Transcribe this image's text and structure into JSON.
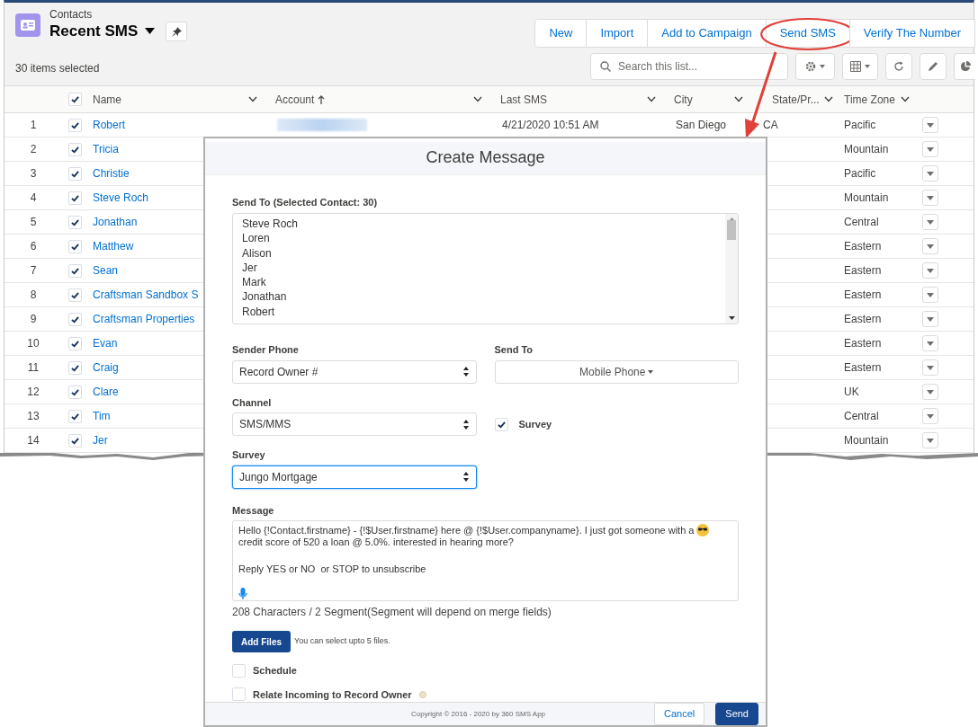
{
  "header": {
    "object_label": "Contacts",
    "list_name": "Recent SMS",
    "selection_count": "30 items selected"
  },
  "actions": [
    {
      "label": "New",
      "circled": false
    },
    {
      "label": "Import",
      "circled": false
    },
    {
      "label": "Add to Campaign",
      "circled": false
    },
    {
      "label": "Send SMS",
      "circled": true
    },
    {
      "label": "Verify The Number",
      "circled": false
    }
  ],
  "search": {
    "placeholder": "Search this list..."
  },
  "select_all": {
    "checked": true
  },
  "columns": [
    {
      "label": "Name"
    },
    {
      "label": "Account",
      "sorted_ascending": true
    },
    {
      "label": "Last SMS"
    },
    {
      "label": "City"
    },
    {
      "label": "State/Pr..."
    },
    {
      "label": "Time Zone"
    }
  ],
  "rows": [
    {
      "number": "1",
      "checked": true,
      "name": "Robert",
      "account_blurred": true,
      "last_sms": "4/21/2020 10:51 AM",
      "city": "San Diego",
      "state": "CA",
      "time_zone": "Pacific"
    },
    {
      "number": "2",
      "checked": true,
      "name": "Tricia",
      "time_zone": "Mountain"
    },
    {
      "number": "3",
      "checked": true,
      "name": "Christie",
      "time_zone": "Pacific"
    },
    {
      "number": "4",
      "checked": true,
      "name": "Steve Roch",
      "time_zone": "Mountain"
    },
    {
      "number": "5",
      "checked": true,
      "name": "Jonathan",
      "time_zone": "Central"
    },
    {
      "number": "6",
      "checked": true,
      "name": "Matthew",
      "time_zone": "Eastern"
    },
    {
      "number": "7",
      "checked": true,
      "name": "Sean",
      "time_zone": "Eastern"
    },
    {
      "number": "8",
      "checked": true,
      "name": "Craftsman Sandbox S",
      "time_zone": "Eastern"
    },
    {
      "number": "9",
      "checked": true,
      "name": "Craftsman Properties",
      "time_zone": "Eastern"
    },
    {
      "number": "10",
      "checked": true,
      "name": "Evan",
      "time_zone": "Eastern"
    },
    {
      "number": "11",
      "checked": true,
      "name": "Craig",
      "time_zone": "Eastern"
    },
    {
      "number": "12",
      "checked": true,
      "name": "Clare",
      "time_zone": "UK"
    },
    {
      "number": "13",
      "checked": true,
      "name": "Tim",
      "time_zone": "Central"
    },
    {
      "number": "14",
      "checked": true,
      "name": "Jer",
      "time_zone": "Mountain"
    }
  ],
  "modal": {
    "title": "Create Message",
    "recipients": {
      "label": "Send To (Selected Contact: 30)",
      "names": [
        "Steve Roch",
        "Loren",
        "Alison",
        "Jer",
        "Mark",
        "Jonathan",
        "Robert"
      ]
    },
    "sender_phone": {
      "label": "Sender Phone",
      "value": "Record Owner #"
    },
    "send_to": {
      "label": "Send To",
      "value": "Mobile Phone"
    },
    "channel": {
      "label": "Channel",
      "value": "SMS/MMS"
    },
    "survey_toggle": {
      "label": "Survey",
      "checked": true
    },
    "survey": {
      "label": "Survey",
      "value": "Jungo Mortgage",
      "focused": true
    },
    "message": {
      "label": "Message",
      "paragraphs": [
        [
          "Hello {!Contact.firstname} - {!$User.firstname} here @ {!$User.companyname}. I just got someone with a",
          "credit score of 520 a loan @ 5.0%. interested in hearing more?"
        ],
        [
          "Reply YES or NO  or STOP to unsubscribe"
        ]
      ]
    },
    "counter": "208 Characters / 2 Segment(Segment will depend on merge fields)",
    "add_files": {
      "label": "Add Files",
      "hint": "You can select upto 5 files."
    },
    "options": [
      {
        "label": "Schedule",
        "checked": false,
        "info": false
      },
      {
        "label": "Relate Incoming to Record Owner",
        "checked": false,
        "info": true
      }
    ],
    "copyright": "Copyright © 2016 - 2020 by 360 SMS App",
    "buttons": [
      {
        "label": "Cancel",
        "kind": "neutral"
      },
      {
        "label": "Send",
        "kind": "brand"
      }
    ]
  }
}
